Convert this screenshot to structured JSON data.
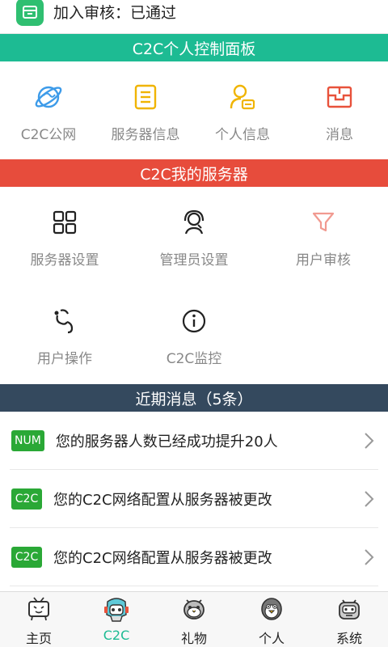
{
  "status": {
    "text": "加入审核：已通过"
  },
  "sections": {
    "control_panel": "C2C个人控制面板",
    "my_servers": "C2C我的服务器",
    "recent": "近期消息（5条）"
  },
  "control_items": [
    {
      "label": "C2C公网",
      "icon": "globe-icon"
    },
    {
      "label": "服务器信息",
      "icon": "document-icon"
    },
    {
      "label": "个人信息",
      "icon": "user-card-icon"
    },
    {
      "label": "消息",
      "icon": "inbox-icon"
    }
  ],
  "server_items": [
    {
      "label": "服务器设置",
      "icon": "grid-icon"
    },
    {
      "label": "管理员设置",
      "icon": "headset-icon"
    },
    {
      "label": "用户审核",
      "icon": "filter-icon"
    },
    {
      "label": "用户操作",
      "icon": "stethoscope-icon"
    },
    {
      "label": "C2C监控",
      "icon": "info-icon"
    }
  ],
  "messages": [
    {
      "badge": "NUM",
      "text": "您的服务器人数已经成功提升20人"
    },
    {
      "badge": "C2C",
      "text": "您的C2C网络配置从服务器被更改"
    },
    {
      "badge": "C2C",
      "text": "您的C2C网络配置从服务器被更改"
    }
  ],
  "tabs": [
    {
      "label": "主页",
      "icon": "tv-mascot-icon"
    },
    {
      "label": "C2C",
      "icon": "miku-mascot-icon",
      "active": true
    },
    {
      "label": "礼物",
      "icon": "bird-mascot-icon"
    },
    {
      "label": "个人",
      "icon": "penguin-mascot-icon"
    },
    {
      "label": "系统",
      "icon": "robot-mascot-icon"
    }
  ],
  "colors": {
    "green": "#1dbb93",
    "red": "#e74c3c",
    "navy": "#34495e",
    "badge_green": "#2aa836",
    "icon_blue": "#3d9be9",
    "icon_yellow": "#f0b400",
    "icon_orange": "#e8523b",
    "icon_pink": "#f19a90"
  }
}
